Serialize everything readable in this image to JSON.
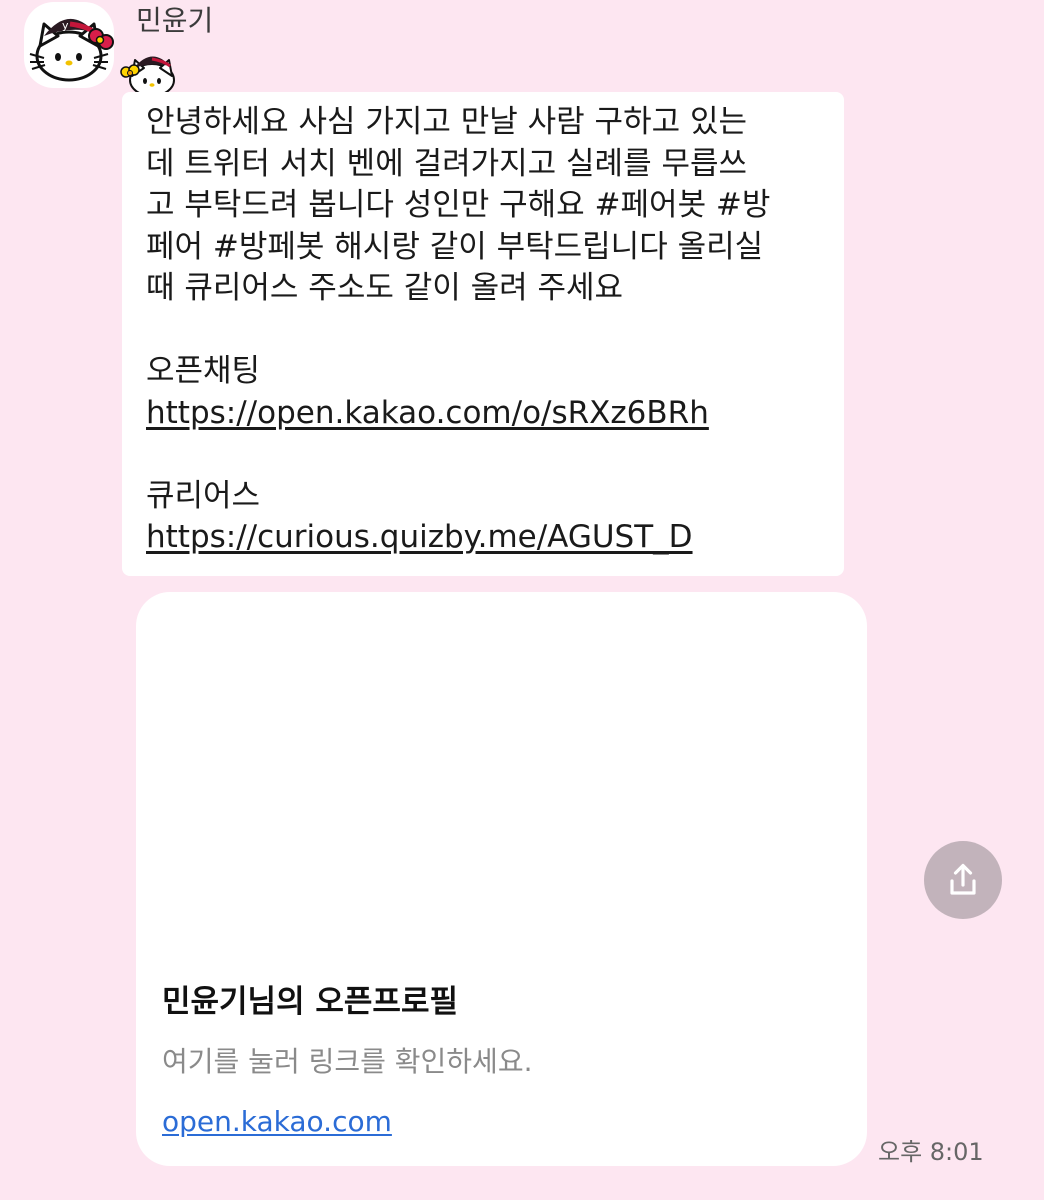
{
  "chat": {
    "sender_name": "민윤기",
    "avatar_icon": "hello-kitty-avatar",
    "sticker_icon": "hello-kitty-sticker",
    "message": {
      "lines": [
        "안녕하세요 사심 가지고 만날 사람 구하고 있는",
        "데 트위터 서치 벤에 걸려가지고 실례를 무릅쓰",
        "고 부탁드려 봅니다 성인만 구해요 #페어봇 #방",
        "페어 #방페봇 해시랑 같이 부탁드립니다 올리실",
        "때 큐리어스 주소도 같이 올려 주세요"
      ],
      "openchat_label": "오픈채팅",
      "openchat_url": "https://open.kakao.com/o/sRXz6BRh",
      "curious_label": "큐리어스",
      "curious_url": "https://curious.quizby.me/AGUST_D"
    },
    "link_card": {
      "title": "민윤기님의 오픈프로필",
      "description": "여기를 눌러 링크를 확인하세요.",
      "domain": "open.kakao.com"
    },
    "share_icon": "share-icon",
    "timestamp": "오후 8:01"
  },
  "colors": {
    "background": "#fde6f1",
    "bubble": "#ffffff",
    "link_blue": "#2b6cd6",
    "share_button": "#c2b3bb"
  }
}
